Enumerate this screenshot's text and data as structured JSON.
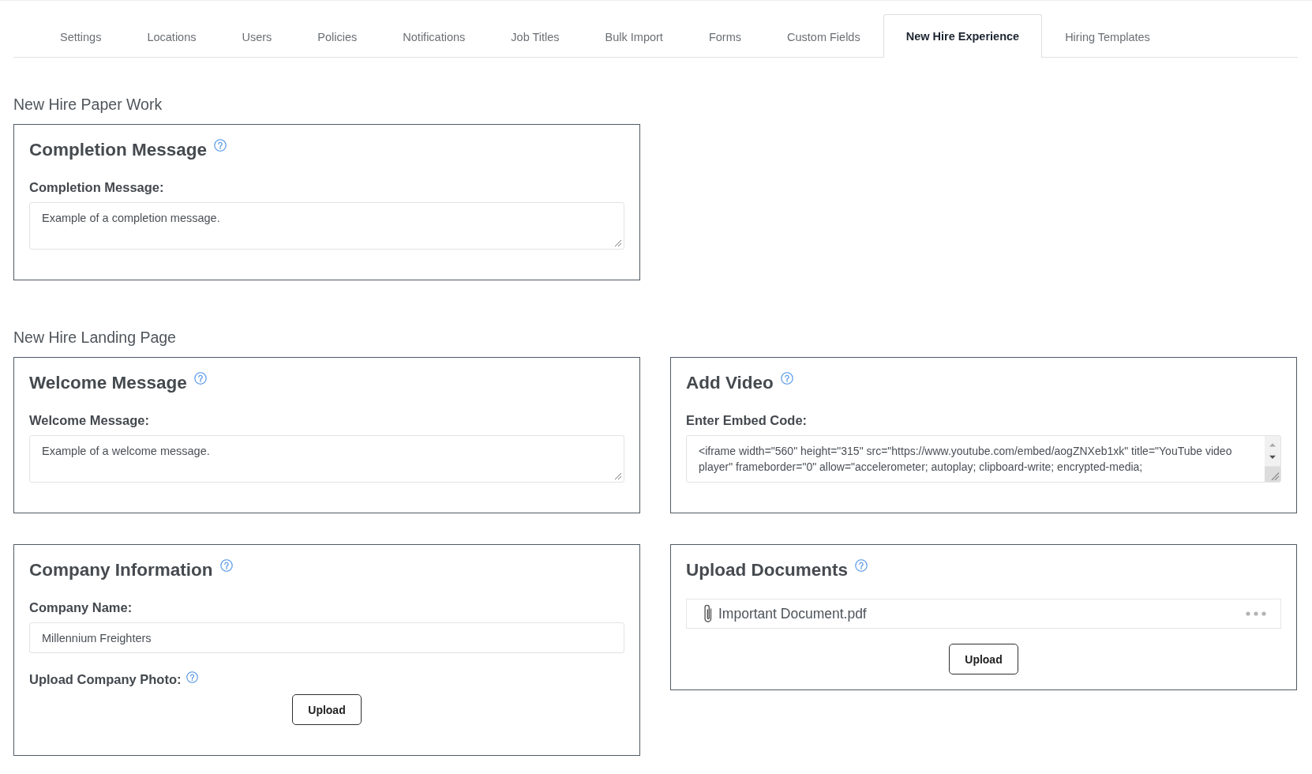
{
  "tabs": [
    {
      "label": "Settings",
      "selected": false
    },
    {
      "label": "Locations",
      "selected": false
    },
    {
      "label": "Users",
      "selected": false
    },
    {
      "label": "Policies",
      "selected": false
    },
    {
      "label": "Notifications",
      "selected": false
    },
    {
      "label": "Job Titles",
      "selected": false
    },
    {
      "label": "Bulk Import",
      "selected": false
    },
    {
      "label": "Forms",
      "selected": false
    },
    {
      "label": "Custom Fields",
      "selected": false
    },
    {
      "label": "New Hire Experience",
      "selected": true
    },
    {
      "label": "Hiring Templates",
      "selected": false
    }
  ],
  "sections": [
    {
      "title": "New Hire Paper Work",
      "cards": [
        {
          "title": "Completion Message",
          "help_icon": true,
          "fields": [
            {
              "kind": "textarea",
              "label": "Completion Message:",
              "help_icon": false,
              "value": "Example of a completion message."
            }
          ]
        }
      ]
    },
    {
      "title": "New Hire Landing Page",
      "cards": [
        {
          "title": "Welcome Message",
          "help_icon": true,
          "fields": [
            {
              "kind": "textarea",
              "label": "Welcome Message:",
              "help_icon": false,
              "value": "Example of a welcome message."
            }
          ]
        },
        {
          "title": "Add Video",
          "help_icon": true,
          "fields": [
            {
              "kind": "code",
              "label": "Enter Embed Code:",
              "help_icon": false,
              "value": "<iframe width=\"560\" height=\"315\" src=\"https://www.youtube.com/embed/aogZNXeb1xk\" title=\"YouTube video player\" frameborder=\"0\" allow=\"accelerometer; autoplay; clipboard-write; encrypted-media;"
            }
          ]
        },
        {
          "title": "Company Information",
          "help_icon": true,
          "fields": [
            {
              "kind": "input",
              "label": "Company Name:",
              "help_icon": false,
              "value": "Millennium Freighters"
            },
            {
              "kind": "upload",
              "label": "Upload Company Photo:",
              "help_icon": true,
              "button": "Upload"
            }
          ]
        },
        {
          "title": "Upload Documents",
          "help_icon": true,
          "fields": [
            {
              "kind": "files",
              "files": [
                {
                  "name": "Important Document.pdf"
                }
              ]
            },
            {
              "kind": "upload",
              "button": "Upload"
            }
          ]
        }
      ]
    }
  ]
}
